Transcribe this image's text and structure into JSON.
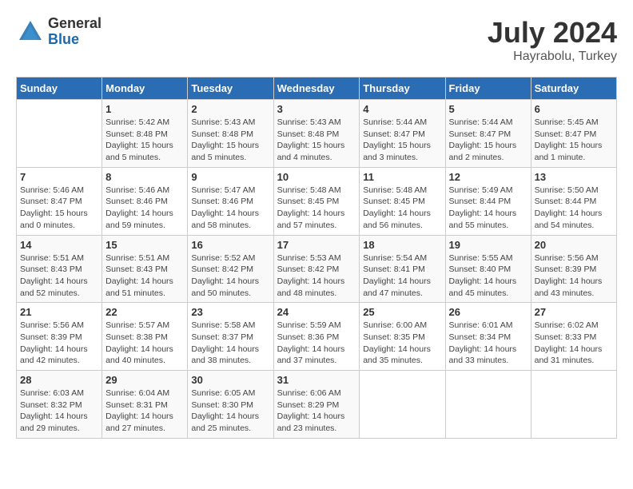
{
  "logo": {
    "general": "General",
    "blue": "Blue"
  },
  "title": {
    "month_year": "July 2024",
    "location": "Hayrabolu, Turkey"
  },
  "weekdays": [
    "Sunday",
    "Monday",
    "Tuesday",
    "Wednesday",
    "Thursday",
    "Friday",
    "Saturday"
  ],
  "weeks": [
    [
      {
        "day": "",
        "sunrise": "",
        "sunset": "",
        "daylight": ""
      },
      {
        "day": "1",
        "sunrise": "Sunrise: 5:42 AM",
        "sunset": "Sunset: 8:48 PM",
        "daylight": "Daylight: 15 hours and 5 minutes."
      },
      {
        "day": "2",
        "sunrise": "Sunrise: 5:43 AM",
        "sunset": "Sunset: 8:48 PM",
        "daylight": "Daylight: 15 hours and 5 minutes."
      },
      {
        "day": "3",
        "sunrise": "Sunrise: 5:43 AM",
        "sunset": "Sunset: 8:48 PM",
        "daylight": "Daylight: 15 hours and 4 minutes."
      },
      {
        "day": "4",
        "sunrise": "Sunrise: 5:44 AM",
        "sunset": "Sunset: 8:47 PM",
        "daylight": "Daylight: 15 hours and 3 minutes."
      },
      {
        "day": "5",
        "sunrise": "Sunrise: 5:44 AM",
        "sunset": "Sunset: 8:47 PM",
        "daylight": "Daylight: 15 hours and 2 minutes."
      },
      {
        "day": "6",
        "sunrise": "Sunrise: 5:45 AM",
        "sunset": "Sunset: 8:47 PM",
        "daylight": "Daylight: 15 hours and 1 minute."
      }
    ],
    [
      {
        "day": "7",
        "sunrise": "Sunrise: 5:46 AM",
        "sunset": "Sunset: 8:47 PM",
        "daylight": "Daylight: 15 hours and 0 minutes."
      },
      {
        "day": "8",
        "sunrise": "Sunrise: 5:46 AM",
        "sunset": "Sunset: 8:46 PM",
        "daylight": "Daylight: 14 hours and 59 minutes."
      },
      {
        "day": "9",
        "sunrise": "Sunrise: 5:47 AM",
        "sunset": "Sunset: 8:46 PM",
        "daylight": "Daylight: 14 hours and 58 minutes."
      },
      {
        "day": "10",
        "sunrise": "Sunrise: 5:48 AM",
        "sunset": "Sunset: 8:45 PM",
        "daylight": "Daylight: 14 hours and 57 minutes."
      },
      {
        "day": "11",
        "sunrise": "Sunrise: 5:48 AM",
        "sunset": "Sunset: 8:45 PM",
        "daylight": "Daylight: 14 hours and 56 minutes."
      },
      {
        "day": "12",
        "sunrise": "Sunrise: 5:49 AM",
        "sunset": "Sunset: 8:44 PM",
        "daylight": "Daylight: 14 hours and 55 minutes."
      },
      {
        "day": "13",
        "sunrise": "Sunrise: 5:50 AM",
        "sunset": "Sunset: 8:44 PM",
        "daylight": "Daylight: 14 hours and 54 minutes."
      }
    ],
    [
      {
        "day": "14",
        "sunrise": "Sunrise: 5:51 AM",
        "sunset": "Sunset: 8:43 PM",
        "daylight": "Daylight: 14 hours and 52 minutes."
      },
      {
        "day": "15",
        "sunrise": "Sunrise: 5:51 AM",
        "sunset": "Sunset: 8:43 PM",
        "daylight": "Daylight: 14 hours and 51 minutes."
      },
      {
        "day": "16",
        "sunrise": "Sunrise: 5:52 AM",
        "sunset": "Sunset: 8:42 PM",
        "daylight": "Daylight: 14 hours and 50 minutes."
      },
      {
        "day": "17",
        "sunrise": "Sunrise: 5:53 AM",
        "sunset": "Sunset: 8:42 PM",
        "daylight": "Daylight: 14 hours and 48 minutes."
      },
      {
        "day": "18",
        "sunrise": "Sunrise: 5:54 AM",
        "sunset": "Sunset: 8:41 PM",
        "daylight": "Daylight: 14 hours and 47 minutes."
      },
      {
        "day": "19",
        "sunrise": "Sunrise: 5:55 AM",
        "sunset": "Sunset: 8:40 PM",
        "daylight": "Daylight: 14 hours and 45 minutes."
      },
      {
        "day": "20",
        "sunrise": "Sunrise: 5:56 AM",
        "sunset": "Sunset: 8:39 PM",
        "daylight": "Daylight: 14 hours and 43 minutes."
      }
    ],
    [
      {
        "day": "21",
        "sunrise": "Sunrise: 5:56 AM",
        "sunset": "Sunset: 8:39 PM",
        "daylight": "Daylight: 14 hours and 42 minutes."
      },
      {
        "day": "22",
        "sunrise": "Sunrise: 5:57 AM",
        "sunset": "Sunset: 8:38 PM",
        "daylight": "Daylight: 14 hours and 40 minutes."
      },
      {
        "day": "23",
        "sunrise": "Sunrise: 5:58 AM",
        "sunset": "Sunset: 8:37 PM",
        "daylight": "Daylight: 14 hours and 38 minutes."
      },
      {
        "day": "24",
        "sunrise": "Sunrise: 5:59 AM",
        "sunset": "Sunset: 8:36 PM",
        "daylight": "Daylight: 14 hours and 37 minutes."
      },
      {
        "day": "25",
        "sunrise": "Sunrise: 6:00 AM",
        "sunset": "Sunset: 8:35 PM",
        "daylight": "Daylight: 14 hours and 35 minutes."
      },
      {
        "day": "26",
        "sunrise": "Sunrise: 6:01 AM",
        "sunset": "Sunset: 8:34 PM",
        "daylight": "Daylight: 14 hours and 33 minutes."
      },
      {
        "day": "27",
        "sunrise": "Sunrise: 6:02 AM",
        "sunset": "Sunset: 8:33 PM",
        "daylight": "Daylight: 14 hours and 31 minutes."
      }
    ],
    [
      {
        "day": "28",
        "sunrise": "Sunrise: 6:03 AM",
        "sunset": "Sunset: 8:32 PM",
        "daylight": "Daylight: 14 hours and 29 minutes."
      },
      {
        "day": "29",
        "sunrise": "Sunrise: 6:04 AM",
        "sunset": "Sunset: 8:31 PM",
        "daylight": "Daylight: 14 hours and 27 minutes."
      },
      {
        "day": "30",
        "sunrise": "Sunrise: 6:05 AM",
        "sunset": "Sunset: 8:30 PM",
        "daylight": "Daylight: 14 hours and 25 minutes."
      },
      {
        "day": "31",
        "sunrise": "Sunrise: 6:06 AM",
        "sunset": "Sunset: 8:29 PM",
        "daylight": "Daylight: 14 hours and 23 minutes."
      },
      {
        "day": "",
        "sunrise": "",
        "sunset": "",
        "daylight": ""
      },
      {
        "day": "",
        "sunrise": "",
        "sunset": "",
        "daylight": ""
      },
      {
        "day": "",
        "sunrise": "",
        "sunset": "",
        "daylight": ""
      }
    ]
  ]
}
